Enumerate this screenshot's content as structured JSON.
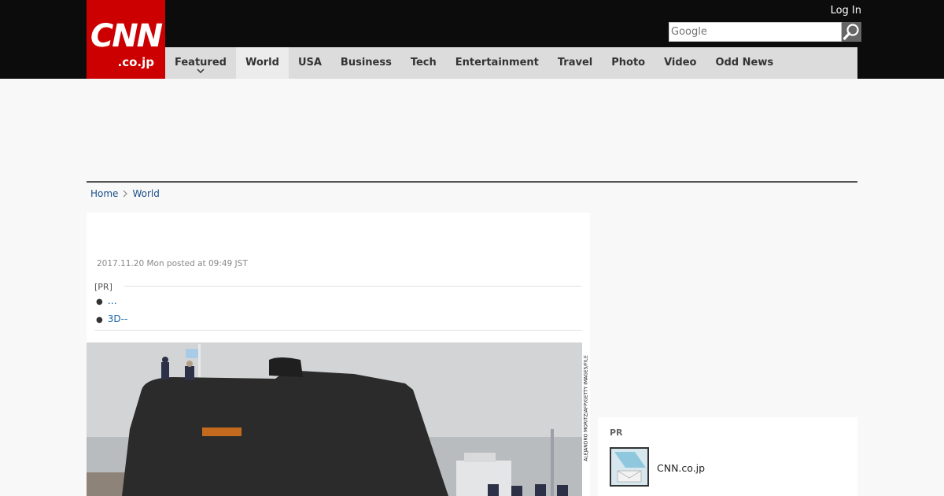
{
  "header": {
    "logo": {
      "line1": "CNN",
      "line2": ".co.jp"
    },
    "login_label": "Log In",
    "search": {
      "placeholder": "Google"
    }
  },
  "nav": {
    "items": [
      {
        "label": "Featured"
      },
      {
        "label": "World"
      },
      {
        "label": "USA"
      },
      {
        "label": "Business"
      },
      {
        "label": "Tech"
      },
      {
        "label": "Entertainment"
      },
      {
        "label": "Travel"
      },
      {
        "label": "Photo"
      },
      {
        "label": "Video"
      },
      {
        "label": "Odd News"
      }
    ]
  },
  "breadcrumb": {
    "home": "Home",
    "section": "World"
  },
  "article": {
    "posted": "2017.11.20 Mon posted at 09:49 JST",
    "pr": {
      "label": "[PR]",
      "links": [
        "…",
        "3D--"
      ]
    },
    "photo_credit": "ALEJANDRO MORITZ/AFP/GETTY IMAGES/FILE"
  },
  "sidebar": {
    "pr_title": "PR",
    "pr_link": "CNN.co.jp"
  },
  "colors": {
    "brand_red": "#cc0000",
    "topbar": "#0c0c0c",
    "nav_bg": "#dcdcdc",
    "link": "#1a4f8a"
  }
}
